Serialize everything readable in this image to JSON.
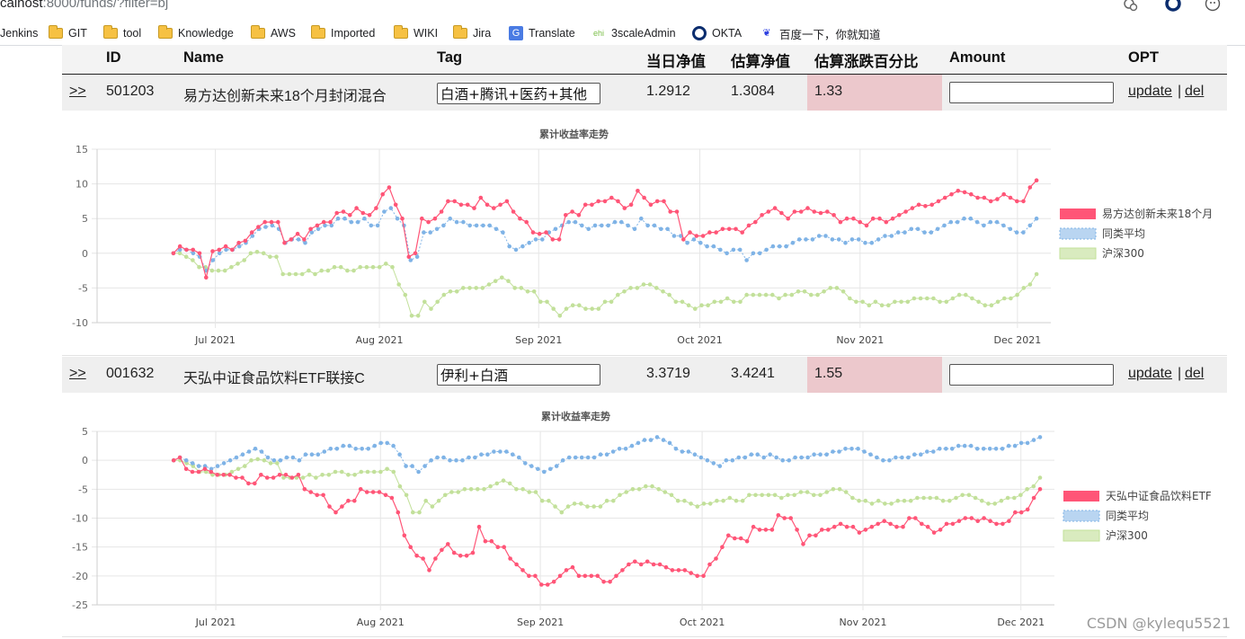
{
  "browser": {
    "url_host": "calhost",
    "url_path": ":8000/funds/?filter=bj",
    "bookmarks": [
      {
        "label": "Jenkins",
        "icon": "none"
      },
      {
        "label": "GIT",
        "icon": "folder"
      },
      {
        "label": "tool",
        "icon": "folder"
      },
      {
        "label": "Knowledge",
        "icon": "folder"
      },
      {
        "label": "AWS",
        "icon": "folder"
      },
      {
        "label": "Imported",
        "icon": "folder"
      },
      {
        "label": "WIKI",
        "icon": "folder"
      },
      {
        "label": "Jira",
        "icon": "folder"
      },
      {
        "label": "Translate",
        "icon": "translate-icon"
      },
      {
        "label": "3scaleAdmin",
        "icon": "ehi-icon"
      },
      {
        "label": "OKTA",
        "icon": "okta-icon"
      },
      {
        "label": "百度一下，你就知道",
        "icon": "baidu-paw-icon"
      }
    ]
  },
  "table": {
    "headers": [
      "ID",
      "Name",
      "Tag",
      "当日净值",
      "估算净值",
      "估算涨跌百分比",
      "Amount",
      "OPT"
    ]
  },
  "funds": [
    {
      "expand": ">>",
      "id": "501203",
      "name": "易方达创新未来18个月封闭混合",
      "tag": "白酒+腾讯+医药+其他",
      "nav": "1.2912",
      "est_nav": "1.3084",
      "est_pct": "1.33",
      "amount": "",
      "update": "update",
      "sep": "|",
      "del": "del"
    },
    {
      "expand": ">>",
      "id": "001632",
      "name": "天弘中证食品饮料ETF联接C",
      "tag": "伊利+白酒",
      "nav": "3.3719",
      "est_nav": "3.4241",
      "est_pct": "1.55",
      "amount": "",
      "update": "update",
      "sep": "|",
      "del": "del"
    }
  ],
  "chart_data": [
    {
      "type": "line",
      "title": "累计收益率走势",
      "xlabel": "",
      "ylabel": "",
      "ylim": [
        -10,
        15
      ],
      "yticks": [
        15,
        10,
        5,
        0,
        -5,
        -10
      ],
      "xticks": [
        "Jul 2021",
        "Aug 2021",
        "Sep 2021",
        "Oct 2021",
        "Nov 2021",
        "Dec 2021"
      ],
      "grid": true,
      "legend": "right",
      "series": [
        {
          "name": "易方达创新未来18个月",
          "color": "#ff5577",
          "values": [
            0,
            1,
            0.5,
            0.5,
            0,
            -3.5,
            0.3,
            0.5,
            1,
            0.5,
            1.5,
            1.8,
            3,
            3.8,
            4.5,
            4.5,
            4.5,
            1.5,
            2,
            2.8,
            2,
            3.5,
            4,
            4.5,
            4.5,
            5.8,
            6,
            5.5,
            6.5,
            5.8,
            5.5,
            6.5,
            8.5,
            9.5,
            7,
            5,
            -0.5,
            0,
            5,
            4.5,
            5,
            6,
            7.5,
            7.5,
            7,
            7,
            6.5,
            8,
            7,
            6.5,
            7,
            7.5,
            6,
            5,
            4.5,
            3,
            2.8,
            3,
            2,
            2,
            5.5,
            6,
            5.5,
            7,
            7,
            7.5,
            7.5,
            8,
            7.5,
            6.5,
            7,
            9,
            8,
            7,
            7.5,
            7.5,
            6,
            6,
            2,
            3,
            2.5,
            2.5,
            3,
            3,
            3.5,
            3.5,
            3.5,
            3,
            4,
            4.5,
            5.5,
            6,
            6.5,
            5.8,
            5,
            6,
            6,
            6.5,
            6,
            5.8,
            6,
            5.5,
            4.5,
            5,
            5,
            4.5,
            4,
            5,
            5,
            4.5,
            5,
            5.5,
            6,
            6.5,
            7,
            6.8,
            7,
            7.5,
            8,
            8.5,
            9,
            8.8,
            8.5,
            8,
            8,
            7.5,
            7.8,
            8.5,
            8,
            7.5,
            7.5,
            9.5,
            10.5
          ]
        },
        {
          "name": "同类平均",
          "color": "#7fb3e6",
          "values": [
            0,
            0.5,
            0.5,
            0,
            -0.5,
            -2.5,
            -1,
            0,
            0.5,
            0.5,
            1,
            1.5,
            2.5,
            3.5,
            3.8,
            4,
            3.5,
            1.5,
            2,
            2,
            1.5,
            3,
            3.5,
            4,
            4,
            5,
            5,
            4.5,
            4.5,
            5,
            4,
            4,
            6,
            6.5,
            5,
            4,
            -1,
            -0.5,
            3,
            3,
            3.5,
            4,
            5,
            4.5,
            4.5,
            4,
            4,
            4,
            4,
            3.5,
            3,
            1,
            0.5,
            1,
            1.5,
            2,
            2,
            3,
            3.5,
            4,
            4.5,
            4.5,
            4,
            3.5,
            4,
            4,
            4,
            4.5,
            4.5,
            4,
            3.5,
            5,
            4,
            4,
            3.5,
            3.5,
            2.5,
            2.5,
            1.5,
            2,
            1.5,
            1,
            1,
            0.5,
            0,
            0.5,
            0.5,
            -1,
            0,
            0,
            0.5,
            1,
            1,
            1,
            1.5,
            2,
            2,
            2,
            2.5,
            2.5,
            2,
            2,
            1.5,
            2,
            2,
            1.5,
            1.5,
            2,
            2.5,
            2.5,
            3,
            3,
            3.5,
            3.5,
            3,
            3,
            3.5,
            4,
            4.5,
            4.5,
            5,
            5,
            4.5,
            4,
            4.5,
            4.5,
            4,
            3.5,
            3,
            3,
            4,
            5
          ]
        },
        {
          "name": "沪深300",
          "color": "#c2e09a",
          "values": [
            0,
            0,
            -0.5,
            -1,
            -2,
            -2,
            -2.5,
            -2.5,
            -2.5,
            -2,
            -1.5,
            -1,
            0,
            0.2,
            0,
            -0.5,
            -0.5,
            -3,
            -3,
            -3,
            -3,
            -2.5,
            -3,
            -2.5,
            -2.5,
            -2,
            -2,
            -2.5,
            -2.5,
            -2,
            -2,
            -2,
            -2,
            -1.5,
            -2,
            -4.5,
            -6,
            -9,
            -9,
            -7,
            -8,
            -7,
            -6,
            -5.5,
            -5.5,
            -5,
            -5,
            -5,
            -5,
            -4.5,
            -4,
            -3.5,
            -4,
            -5,
            -5,
            -5.5,
            -5.5,
            -7,
            -7,
            -8,
            -9,
            -8,
            -7.5,
            -7.5,
            -8,
            -8,
            -8,
            -7,
            -7,
            -6,
            -5.5,
            -5,
            -5,
            -4.5,
            -4.5,
            -5,
            -5.5,
            -6,
            -7,
            -7,
            -7.5,
            -8,
            -7.5,
            -7.5,
            -7,
            -7,
            -6.5,
            -7,
            -7,
            -6,
            -6,
            -6,
            -6,
            -6,
            -6.5,
            -6,
            -6,
            -5.5,
            -5.5,
            -6,
            -6,
            -5.5,
            -5,
            -5,
            -5.5,
            -6.5,
            -7,
            -7,
            -7.5,
            -7,
            -7.5,
            -7.5,
            -7,
            -7,
            -7,
            -6.5,
            -6.5,
            -6.5,
            -6.5,
            -7,
            -7,
            -6.5,
            -6,
            -6,
            -6.5,
            -7,
            -7.5,
            -7.5,
            -7,
            -6.5,
            -6.5,
            -6,
            -5,
            -4.5,
            -3
          ]
        }
      ]
    },
    {
      "type": "line",
      "title": "累计收益率走势",
      "xlabel": "",
      "ylabel": "",
      "ylim": [
        -25,
        5
      ],
      "yticks": [
        5,
        0,
        -5,
        -10,
        -15,
        -20,
        -25
      ],
      "xticks": [
        "Jul 2021",
        "Aug 2021",
        "Sep 2021",
        "Oct 2021",
        "Nov 2021",
        "Dec 2021"
      ],
      "grid": true,
      "legend": "right",
      "series": [
        {
          "name": "天弘中证食品饮料ETF",
          "color": "#ff5577",
          "values": [
            0,
            0.5,
            -1.5,
            -2,
            -2,
            -1.5,
            -2,
            -2.5,
            -2.5,
            -2.5,
            -3,
            -3,
            -4,
            -4,
            -2.5,
            -3,
            -3,
            -2.5,
            -2.5,
            -3,
            -2.5,
            -5,
            -5.5,
            -6,
            -6,
            -8,
            -9,
            -8,
            -7,
            -7,
            -5,
            -5.5,
            -5.5,
            -5.5,
            -6,
            -6.5,
            -9,
            -13,
            -15,
            -16.5,
            -17,
            -19,
            -17,
            -15.5,
            -14.5,
            -16,
            -16.5,
            -16.5,
            -16,
            -11.5,
            -14,
            -14,
            -15,
            -15,
            -17,
            -18,
            -19,
            -20,
            -20,
            -21.5,
            -21.5,
            -21,
            -20,
            -19,
            -18.5,
            -20,
            -20,
            -20,
            -20,
            -21,
            -21,
            -20,
            -19,
            -18,
            -17.5,
            -18,
            -17.5,
            -18,
            -18,
            -18.5,
            -19,
            -19,
            -19,
            -19.5,
            -20,
            -20,
            -18,
            -17,
            -15,
            -13,
            -13.5,
            -13.5,
            -14,
            -11.5,
            -12,
            -12,
            -12,
            -9.5,
            -10,
            -10,
            -12,
            -14.5,
            -13,
            -13,
            -12,
            -12,
            -11.5,
            -11,
            -11.5,
            -11.5,
            -12.5,
            -12,
            -11.5,
            -11,
            -10.5,
            -11,
            -11.5,
            -11.5,
            -10,
            -10,
            -11,
            -11.5,
            -12.5,
            -12,
            -11,
            -11,
            -10.5,
            -10,
            -10,
            -10.5,
            -10,
            -10.5,
            -11,
            -11,
            -10.5,
            -9,
            -9,
            -8.5,
            -6.5,
            -5
          ]
        },
        {
          "name": "同类平均",
          "color": "#7fb3e6",
          "values": [
            0,
            0.5,
            0,
            -0.5,
            -1,
            -1,
            -1.5,
            -1,
            -0.5,
            0,
            0.5,
            1,
            1.5,
            2,
            1.5,
            0.5,
            0,
            0,
            0.5,
            0.5,
            0,
            1,
            1,
            1,
            1.5,
            2,
            2,
            2.5,
            2.5,
            2,
            2,
            2,
            2.5,
            3,
            3,
            2.5,
            1,
            -1,
            -1,
            -2,
            -1,
            0,
            0.5,
            0.5,
            0,
            0,
            0,
            0.5,
            0.5,
            1,
            1,
            1.5,
            1.5,
            1.5,
            1,
            0.5,
            -0.5,
            -1,
            -1.5,
            -2,
            -1.5,
            -1,
            0,
            0.5,
            0.5,
            0.5,
            0.5,
            0.5,
            1,
            1,
            1.5,
            2,
            2,
            2.5,
            3,
            3.5,
            3.5,
            4,
            3.5,
            3,
            2,
            1.5,
            1.5,
            1,
            0.5,
            0,
            -0.5,
            -1,
            0,
            0,
            0.5,
            0.5,
            1,
            1,
            0.5,
            1,
            0.5,
            0,
            0,
            0.5,
            0.5,
            0.5,
            1,
            1,
            1,
            1.5,
            1.5,
            2,
            2,
            2,
            1.5,
            1,
            0.5,
            0,
            0,
            0.5,
            0.5,
            0.5,
            1,
            1,
            1.5,
            1.5,
            2,
            2,
            2,
            2.5,
            2.5,
            2.5,
            2,
            2,
            2,
            2,
            2,
            2.5,
            2.5,
            3,
            3,
            3.5,
            4
          ]
        },
        {
          "name": "沪深300",
          "color": "#c2e09a",
          "values": [
            0,
            0,
            -0.5,
            -1,
            -2,
            -2,
            -2.5,
            -2.5,
            -2.5,
            -2,
            -1.5,
            -1,
            0,
            0.2,
            0,
            -0.5,
            -0.5,
            -3,
            -3,
            -3,
            -3,
            -2.5,
            -3,
            -2.5,
            -2.5,
            -2,
            -2,
            -2.5,
            -2.5,
            -2,
            -2,
            -2,
            -2,
            -1.5,
            -2,
            -4.5,
            -6,
            -9,
            -9,
            -7,
            -8,
            -7,
            -6,
            -5.5,
            -5.5,
            -5,
            -5,
            -5,
            -5,
            -4.5,
            -4,
            -3.5,
            -4,
            -5,
            -5,
            -5.5,
            -5.5,
            -7,
            -7,
            -8,
            -9,
            -8,
            -7.5,
            -7.5,
            -8,
            -8,
            -8,
            -7,
            -7,
            -6,
            -5.5,
            -5,
            -5,
            -4.5,
            -4.5,
            -5,
            -5.5,
            -6,
            -7,
            -7,
            -7.5,
            -8,
            -7.5,
            -7.5,
            -7,
            -7,
            -6.5,
            -7,
            -7,
            -6,
            -6,
            -6,
            -6,
            -6,
            -6.5,
            -6,
            -6,
            -5.5,
            -5.5,
            -6,
            -6,
            -5.5,
            -5,
            -5,
            -5.5,
            -6.5,
            -7,
            -7,
            -7.5,
            -7,
            -7.5,
            -7.5,
            -7,
            -7,
            -7,
            -6.5,
            -6.5,
            -6.5,
            -6.5,
            -7,
            -7,
            -6.5,
            -6,
            -6,
            -6.5,
            -7,
            -7.5,
            -7.5,
            -7,
            -6.5,
            -6.5,
            -6,
            -5,
            -4.5,
            -3
          ]
        }
      ]
    }
  ],
  "watermark": "CSDN @kylequ5521"
}
